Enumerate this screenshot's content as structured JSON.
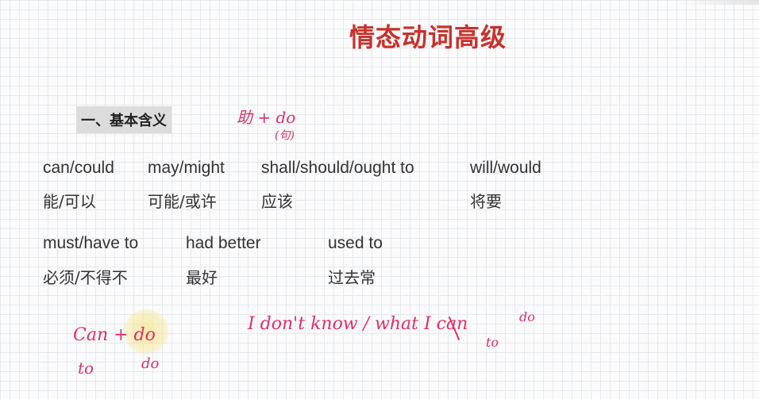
{
  "slide": {
    "title": "情态动词高级",
    "section_heading": "一、基本含义"
  },
  "modals_row1": [
    {
      "word": "can/could",
      "meaning": "能/可以"
    },
    {
      "word": "may/might",
      "meaning": "可能/或许"
    },
    {
      "word": "shall/should/ought to",
      "meaning": "应该"
    },
    {
      "word": "will/would",
      "meaning": "将要"
    }
  ],
  "modals_row2": [
    {
      "word": "must/have to",
      "meaning": "必须/不得不"
    },
    {
      "word": "had better",
      "meaning": "最好"
    },
    {
      "word": "used to",
      "meaning": "过去常"
    }
  ],
  "annotations": {
    "aux_plus_do": "助 + do",
    "aux_note": "(句)",
    "can_plus_do": "Can + do",
    "to": "to",
    "do": "do",
    "sentence": "I don't know / what I can",
    "sentence_do": "do",
    "sentence_to": "to"
  },
  "colors": {
    "title": "#c8322c",
    "handwriting": "#e0306a",
    "highlight": "#f7e896"
  }
}
